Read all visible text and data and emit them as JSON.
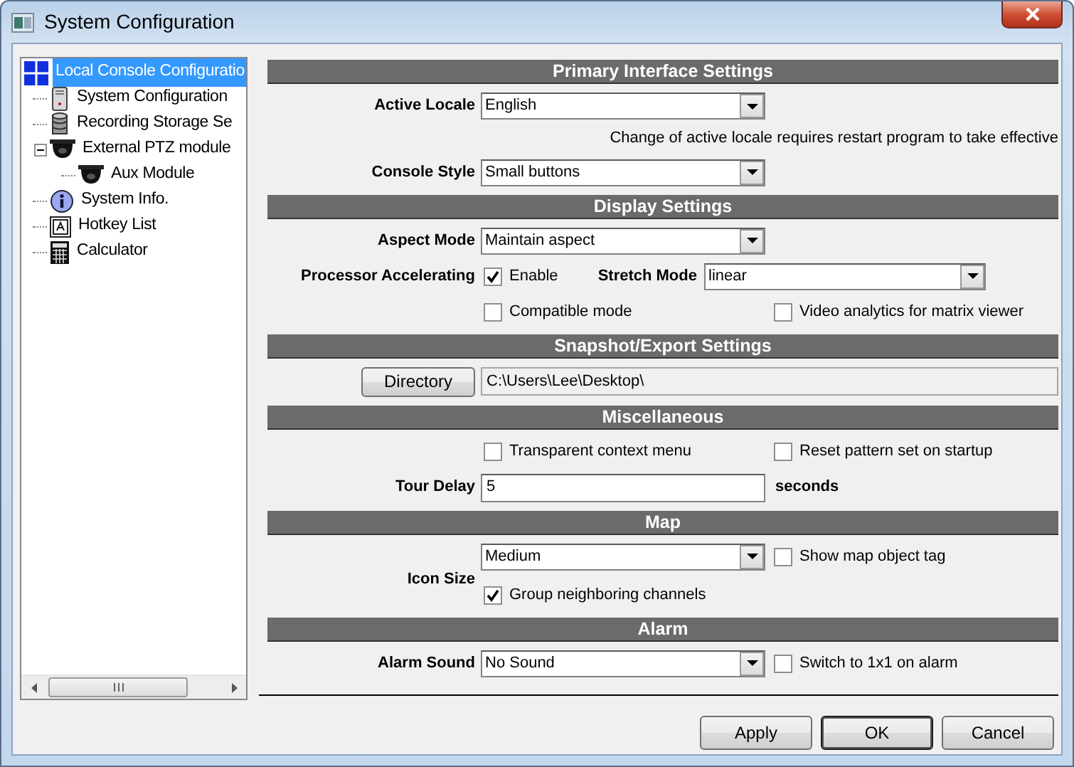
{
  "window": {
    "title": "System Configuration"
  },
  "tree": {
    "items": [
      {
        "label": "Local Console Configuratio",
        "kind": "grid",
        "selected": true,
        "children": [
          {
            "label": "System Configuration",
            "kind": "server",
            "selected": false
          },
          {
            "label": "Recording Storage Se",
            "kind": "storage",
            "selected": false
          },
          {
            "label": "External PTZ module",
            "kind": "camera",
            "selected": false,
            "expanded": true,
            "children": [
              {
                "label": "Aux Module",
                "kind": "camera",
                "selected": false
              }
            ]
          },
          {
            "label": "System Info.",
            "kind": "info",
            "selected": false
          },
          {
            "label": "Hotkey List",
            "kind": "hotkey",
            "selected": false
          },
          {
            "label": "Calculator",
            "kind": "calculator",
            "selected": false
          }
        ]
      }
    ]
  },
  "sections": [
    {
      "title": "Primary Interface Settings",
      "rows": [
        {
          "kind": "select",
          "label": "Active Locale",
          "value": "English"
        },
        {
          "kind": "note",
          "text": "Change of active locale requires restart program to take effective"
        },
        {
          "kind": "select",
          "label": "Console Style",
          "value": "Small buttons"
        }
      ]
    },
    {
      "title": "Display Settings",
      "rows": [
        {
          "kind": "select",
          "label": "Aspect Mode",
          "value": "Maintain aspect"
        },
        {
          "kind": "accel",
          "label": "Processor Accelerating",
          "check": {
            "label": "Enable",
            "checked": true
          },
          "select": {
            "label": "Stretch Mode",
            "value": "linear"
          }
        },
        {
          "kind": "checks",
          "checks": [
            {
              "label": "Compatible mode",
              "checked": false
            },
            {
              "label": "Video analytics for matrix viewer",
              "checked": false
            }
          ]
        }
      ]
    },
    {
      "title": "Snapshot/Export Settings",
      "rows": [
        {
          "kind": "directory",
          "button": "Directory",
          "path": "C:\\Users\\Lee\\Desktop\\"
        }
      ]
    },
    {
      "title": "Miscellaneous",
      "rows": [
        {
          "kind": "checks",
          "checks": [
            {
              "label": "Transparent context menu",
              "checked": false
            },
            {
              "label": "Reset pattern set on startup",
              "checked": false
            }
          ]
        },
        {
          "kind": "input",
          "label": "Tour Delay",
          "value": "5",
          "unit": "seconds"
        }
      ]
    },
    {
      "title": "Map",
      "rows": [
        {
          "kind": "select2",
          "label": "Icon Size",
          "value": "Medium",
          "checks": [
            {
              "label": "Show map object tag",
              "checked": false
            },
            {
              "label": "Group neighboring channels",
              "checked": true
            }
          ]
        }
      ]
    },
    {
      "title": "Alarm",
      "rows": [
        {
          "kind": "select",
          "label": "Alarm Sound",
          "value": "No Sound",
          "check": {
            "label": "Switch to 1x1 on alarm",
            "checked": false
          }
        }
      ]
    }
  ],
  "buttons": [
    {
      "label": "Apply",
      "default": false
    },
    {
      "label": "OK",
      "default": true
    },
    {
      "label": "Cancel",
      "default": false
    }
  ]
}
